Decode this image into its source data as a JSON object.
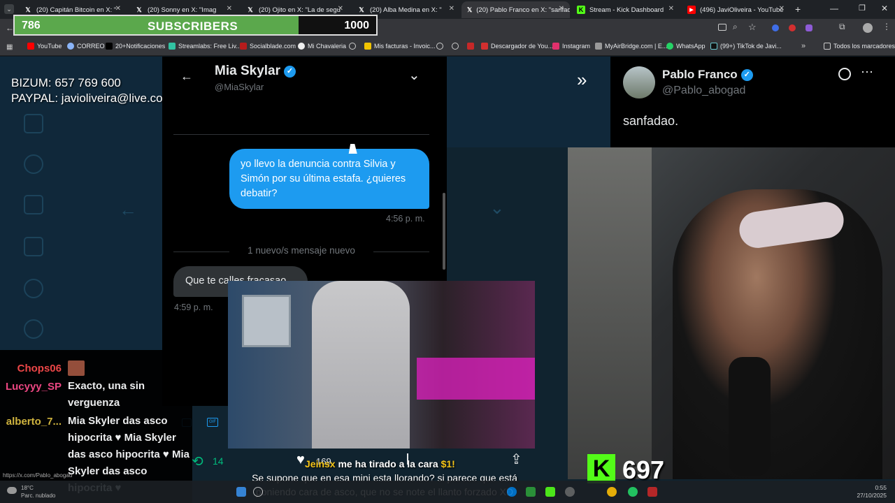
{
  "browser": {
    "tabs": [
      {
        "label": "(20) Capitán Bitcoin en X: \"",
        "icon": "x-icon"
      },
      {
        "label": "(20) Sonny en X: \"Imag",
        "icon": "x-icon"
      },
      {
        "label": "(20) Ojito en X: \"La de segu",
        "icon": "x-icon"
      },
      {
        "label": "(20) Alba Medina en X: \"",
        "icon": "x-icon"
      },
      {
        "label": "(20) Pablo Franco en X: \"sanfad",
        "icon": "x-icon",
        "active": true
      },
      {
        "label": "Stream - Kick Dashboard",
        "icon": "kick-icon"
      },
      {
        "label": "(496) JaviOliveira - YouTube",
        "icon": "youtube-icon"
      }
    ],
    "bookmarks": [
      "YouTube",
      "CORREO",
      "20+Notificaciones",
      "Streamlabs: Free Liv...",
      "Socialblade.com",
      "Mi Chavaleria",
      "Mis facturas - Invoic...",
      "Descargador de You...",
      "Instagram",
      "MyAirBridge.com | E...",
      "WhatsApp",
      "(99+) TikTok de Javi..."
    ],
    "all_bookmarks": "Todos los marcadores",
    "status_url": "https://x.com/Pablo_abogad"
  },
  "subscriber_goal": {
    "current": "786",
    "label": "SUBSCRIBERS",
    "goal": "1000",
    "fill_fraction": 0.786,
    "fill_color": "#5ba84c"
  },
  "donation": {
    "bizum": "BIZUM: 657 769 600",
    "paypal": "PAYPAL: javioliveira@live.com"
  },
  "dm": {
    "contact_name": "Mia Skylar",
    "contact_handle": "@MiaSkylar",
    "sent_message": "yo llevo la denuncia contra Silvia y Simón por su última estafa. ¿quieres debatir?",
    "sent_time": "4:56 p. m.",
    "new_messages_divider": "1 nuevo/s mensaje nuevo",
    "received_message": "Que te calles fracasao",
    "received_time": "4:59 p. m."
  },
  "tweet": {
    "author_name": "Pablo Franco",
    "author_handle": "@Pablo_abogad",
    "text": "sanfadao."
  },
  "tweet_actions": {
    "retweets": "14",
    "likes": "169"
  },
  "kick": {
    "logo": "K",
    "viewers": "697",
    "brand_color": "#53fc18"
  },
  "chat": [
    {
      "user": "Chops06",
      "user_color": "#ff4a4a",
      "message": ""
    },
    {
      "user": "Lucyyy_SP",
      "user_color": "#ff4a8a",
      "message": "Exacto, una sin verguenza"
    },
    {
      "user": "alberto_7...",
      "user_color": "#e0c040",
      "message": "Mia Skyler das asco hipocrita ♥ Mia Skyler das asco hipocrita ♥ Mia Skyler das asco hipocrita ♥"
    }
  ],
  "alert": {
    "user": "Jeinsx",
    "text": "me ha tirado a la cara",
    "amount": "$1!"
  },
  "subtitle": "Se supone que en esa mini esta llorando? si parece que está poniendo cara de asco, que no se note el llanto forzado XD",
  "taskbar": {
    "temperature": "18°C",
    "weather": "Parc. nublado",
    "time": "0:55",
    "date": "27/10/2025"
  }
}
